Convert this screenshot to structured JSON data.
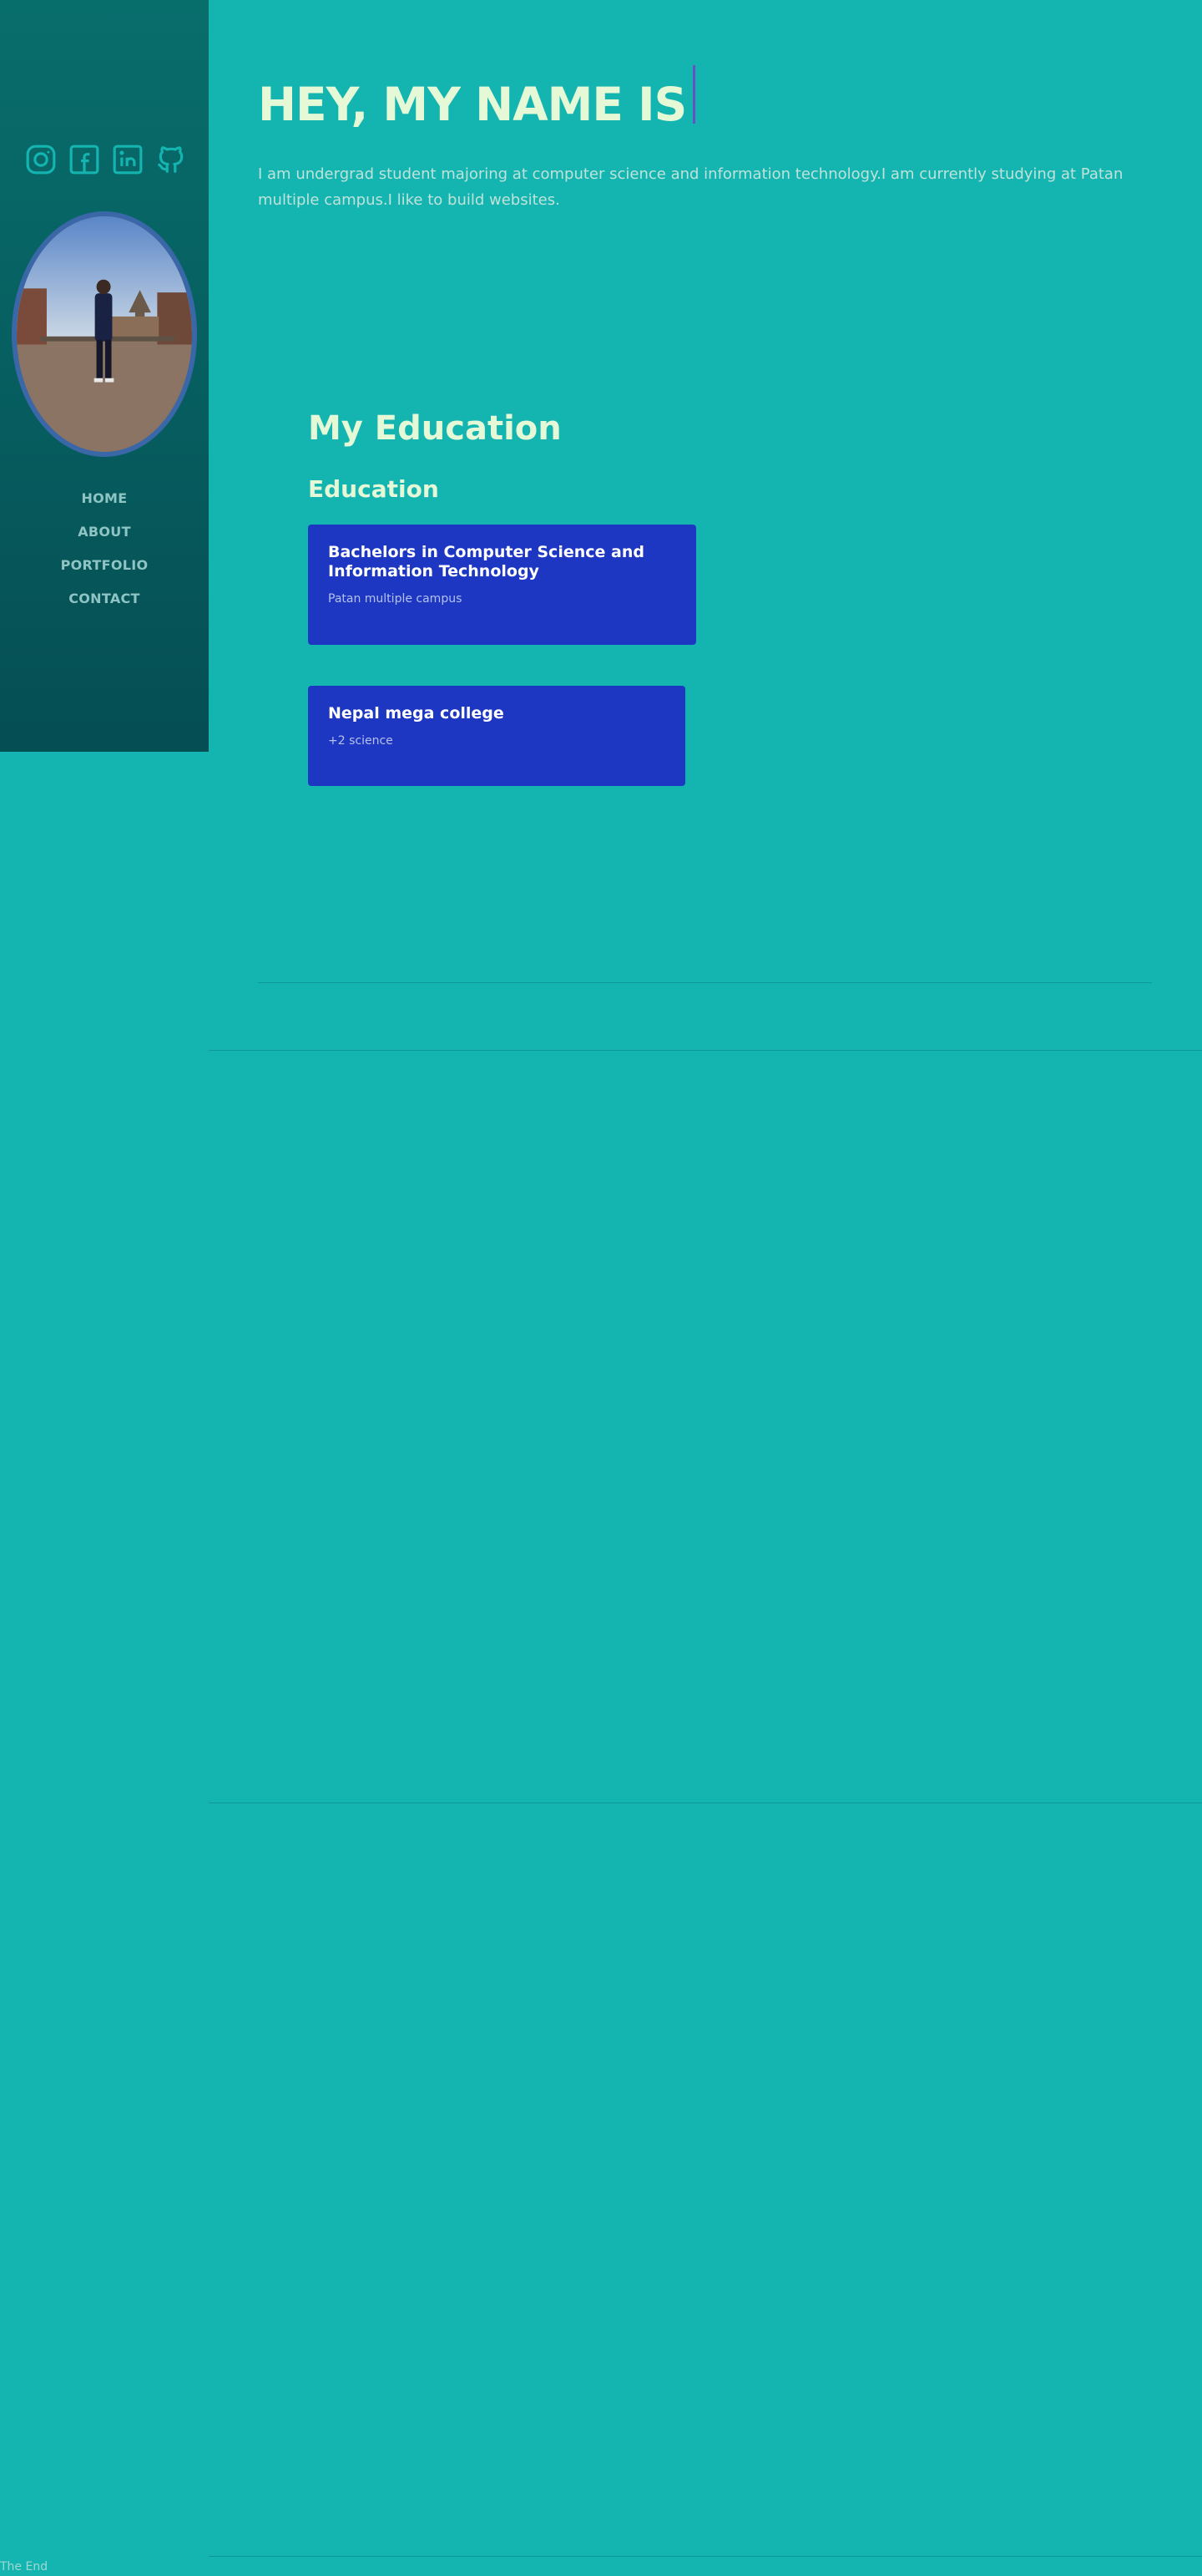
{
  "sidebar": {
    "social_links": [
      {
        "icon": "instagram-icon"
      },
      {
        "icon": "facebook-icon"
      },
      {
        "icon": "linkedin-icon"
      },
      {
        "icon": "github-icon"
      }
    ],
    "nav": [
      {
        "label": "HOME"
      },
      {
        "label": "ABOUT"
      },
      {
        "label": "PORTFOLIO"
      },
      {
        "label": "CONTACT"
      }
    ]
  },
  "hero": {
    "title": "HEY, MY NAME IS",
    "description": "I am undergrad student majoring at computer science and information technology.I am currently studying at Patan multiple campus.I like to build websites."
  },
  "education": {
    "heading": "My Education",
    "subheading": "Education",
    "items": [
      {
        "title": "Bachelors in Computer Science and Information Technology",
        "subtitle": "Patan multiple campus"
      },
      {
        "title": "Nepal mega college",
        "subtitle": "+2 science"
      }
    ]
  },
  "footer": {
    "text": "The End"
  },
  "colors": {
    "page_background": "#14b4b1",
    "sidebar_top": "#086e6c",
    "sidebar_bottom": "#054e53",
    "card_background": "#1d37c3",
    "heading_text": "#e6f9d6",
    "cursor": "#6a4ec4"
  }
}
